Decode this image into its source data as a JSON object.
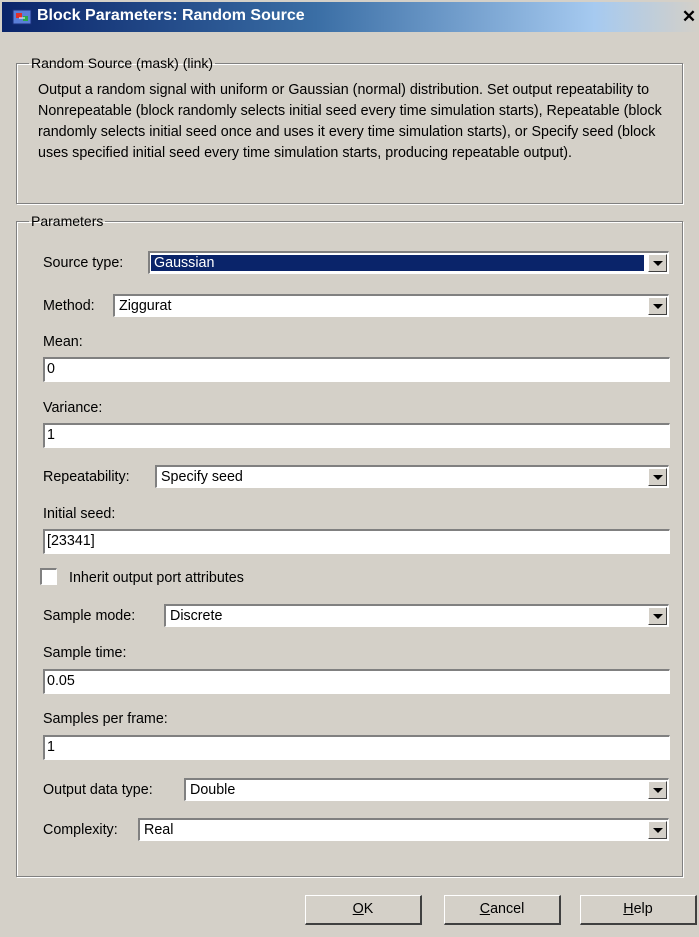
{
  "window": {
    "title": "Block Parameters: Random Source",
    "close_glyph": "✕"
  },
  "mask_group": {
    "legend": "Random Source (mask) (link)",
    "description": "Output a random signal with uniform or Gaussian (normal) distribution.  Set output repeatability to Nonrepeatable (block randomly selects initial seed every time simulation starts), Repeatable (block randomly selects initial seed once and uses it every time simulation starts), or Specify seed (block uses specified initial seed every time simulation starts, producing repeatable output)."
  },
  "parameters": {
    "legend": "Parameters",
    "source_type": {
      "label": "Source type:",
      "value": "Gaussian"
    },
    "method": {
      "label": "Method:",
      "value": "Ziggurat"
    },
    "mean": {
      "label": "Mean:",
      "value": "0"
    },
    "variance": {
      "label": "Variance:",
      "value": "1"
    },
    "repeatability": {
      "label": "Repeatability:",
      "value": "Specify seed"
    },
    "initial_seed": {
      "label": "Initial seed:",
      "value": "[23341]"
    },
    "inherit": {
      "label": "Inherit output port attributes",
      "checked": false
    },
    "sample_mode": {
      "label": "Sample mode:",
      "value": "Discrete"
    },
    "sample_time": {
      "label": "Sample time:",
      "value": "0.05"
    },
    "samples_per_frame": {
      "label": "Samples per frame:",
      "value": "1"
    },
    "output_data_type": {
      "label": "Output data type:",
      "value": "Double"
    },
    "complexity": {
      "label": "Complexity:",
      "value": "Real"
    }
  },
  "buttons": {
    "ok_mnemonic": "O",
    "ok_rest": "K",
    "cancel_mnemonic": "C",
    "cancel_rest": "ancel",
    "help_mnemonic": "H",
    "help_rest": "elp"
  }
}
